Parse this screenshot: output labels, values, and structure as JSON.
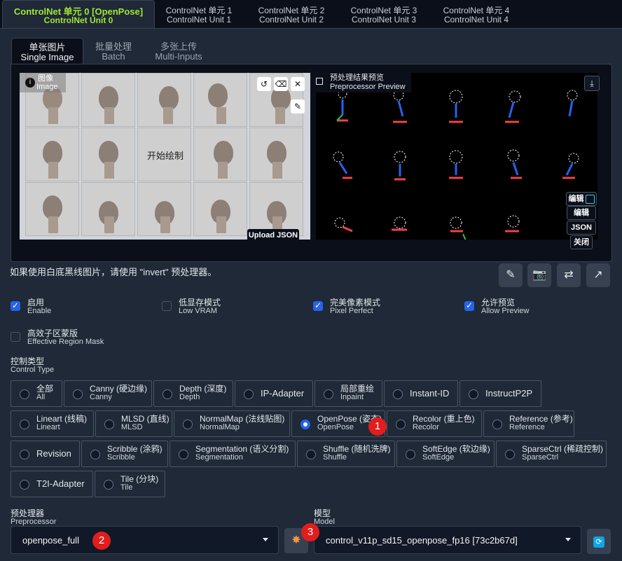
{
  "unit_tabs": [
    {
      "l1": "ControlNet 单元 0 [OpenPose]",
      "l2": "ControlNet Unit 0"
    },
    {
      "l1": "ControlNet 单元 1",
      "l2": "ControlNet Unit 1"
    },
    {
      "l1": "ControlNet 单元 2",
      "l2": "ControlNet Unit 2"
    },
    {
      "l1": "ControlNet 单元 3",
      "l2": "ControlNet Unit 3"
    },
    {
      "l1": "ControlNet 单元 4",
      "l2": "ControlNet Unit 4"
    }
  ],
  "sub_tabs": [
    {
      "l1": "单张图片",
      "l2": "Single Image"
    },
    {
      "l1": "批量处理",
      "l2": "Batch"
    },
    {
      "l1": "多张上传",
      "l2": "Multi-Inputs"
    }
  ],
  "image": {
    "label_cn": "图像",
    "label_en": "Image",
    "center_text": "开始绘制",
    "upload_json": "Upload JSON"
  },
  "preview": {
    "label_cn": "预处理结果预览",
    "label_en": "Preprocessor Preview",
    "edit_btn": "编辑",
    "edit_btn2": "编辑",
    "json_btn": "JSON",
    "close_btn": "关闭"
  },
  "hint": "如果使用白底黑线图片，请使用 \"invert\" 预处理器。",
  "checkboxes": [
    {
      "cn": "启用",
      "en": "Enable",
      "checked": true
    },
    {
      "cn": "低显存模式",
      "en": "Low VRAM",
      "checked": false
    },
    {
      "cn": "完美像素模式",
      "en": "Pixel Perfect",
      "checked": true
    },
    {
      "cn": "允许预览",
      "en": "Allow Preview",
      "checked": true
    },
    {
      "cn": "高效子区蒙版",
      "en": "Effective Region Mask",
      "checked": false
    }
  ],
  "control_type": {
    "cn": "控制类型",
    "en": "Control Type"
  },
  "control_types": [
    {
      "cn": "全部",
      "en": "All"
    },
    {
      "cn": "Canny (硬边缘)",
      "en": "Canny"
    },
    {
      "cn": "Depth (深度)",
      "en": "Depth"
    },
    {
      "cn": "IP-Adapter",
      "en": ""
    },
    {
      "cn": "局部重绘",
      "en": "Inpaint"
    },
    {
      "cn": "Instant-ID",
      "en": ""
    },
    {
      "cn": "InstructP2P",
      "en": ""
    },
    {
      "cn": "Lineart (线稿)",
      "en": "Lineart"
    },
    {
      "cn": "MLSD (直线)",
      "en": "MLSD"
    },
    {
      "cn": "NormalMap (法线贴图)",
      "en": "NormalMap"
    },
    {
      "cn": "OpenPose (姿态)",
      "en": "OpenPose"
    },
    {
      "cn": "Recolor (重上色)",
      "en": "Recolor"
    },
    {
      "cn": "Reference (参考)",
      "en": "Reference"
    },
    {
      "cn": "Revision",
      "en": ""
    },
    {
      "cn": "Scribble (涂鸦)",
      "en": "Scribble"
    },
    {
      "cn": "Segmentation (语义分割)",
      "en": "Segmentation"
    },
    {
      "cn": "Shuffle (随机洗牌)",
      "en": "Shuffle"
    },
    {
      "cn": "SoftEdge (软边缘)",
      "en": "SoftEdge"
    },
    {
      "cn": "SparseCtrl (稀疏控制)",
      "en": "SparseCtrl"
    },
    {
      "cn": "T2I-Adapter",
      "en": ""
    },
    {
      "cn": "Tile (分块)",
      "en": "Tile"
    }
  ],
  "selected_control_type": "OpenPose",
  "preprocessor": {
    "cn": "预处理器",
    "en": "Preprocessor",
    "value": "openpose_full"
  },
  "model": {
    "cn": "模型",
    "en": "Model",
    "value": "control_v11p_sd15_openpose_fp16 [73c2b67d]"
  },
  "badges": [
    "1",
    "2",
    "3"
  ],
  "icons": {
    "undo": "undo-icon",
    "erase": "eraser-icon",
    "close": "close-icon",
    "brush": "brush-icon",
    "download": "download-icon",
    "edit_file": "edit-file-icon",
    "camera": "camera-icon",
    "swap": "swap-icon",
    "send": "send-icon",
    "explode": "run-preprocessor-icon",
    "refresh": "refresh-icon"
  },
  "colors": {
    "accent": "#2563eb",
    "active_tab": "#a3e635",
    "badge": "#e11d1d"
  }
}
